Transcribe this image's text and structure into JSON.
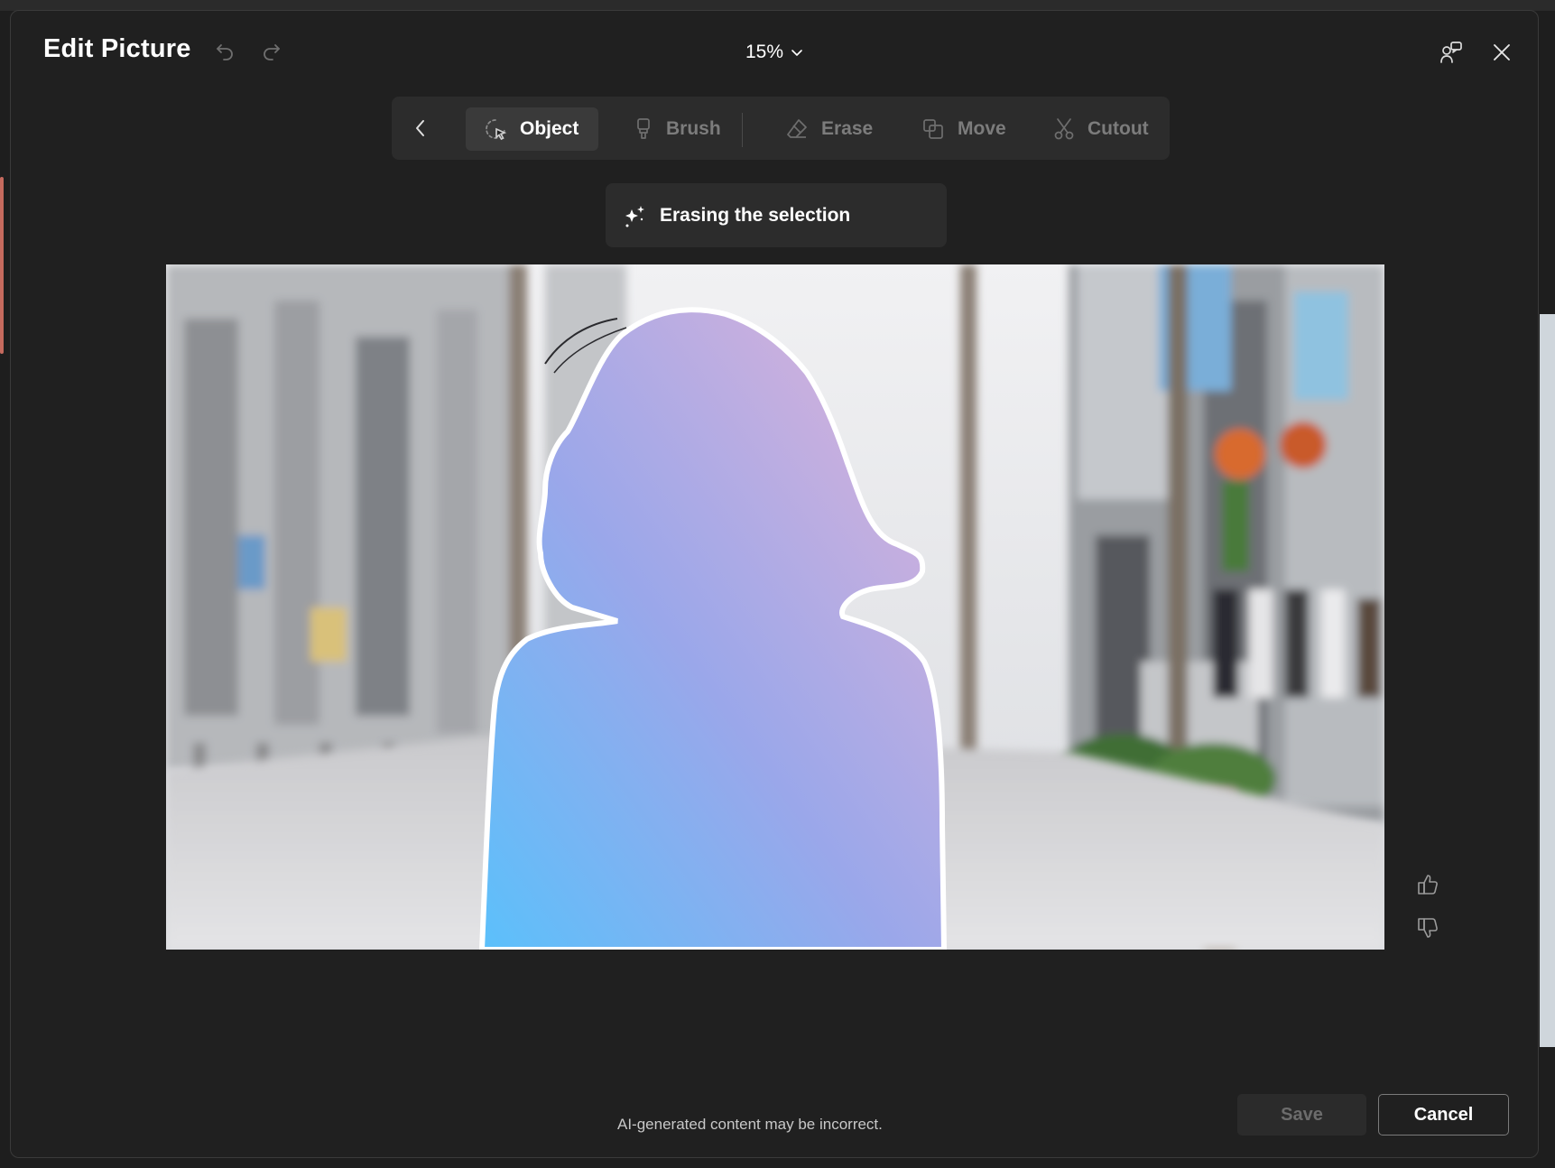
{
  "dialog": {
    "title": "Edit Picture",
    "zoom": "15%"
  },
  "toolbar": {
    "items": [
      {
        "label": "Object",
        "icon": "object-select-icon",
        "active": true
      },
      {
        "label": "Brush",
        "icon": "brush-icon",
        "active": false
      },
      {
        "label": "Erase",
        "icon": "eraser-icon",
        "active": false
      },
      {
        "label": "Move",
        "icon": "move-icon",
        "active": false
      },
      {
        "label": "Cutout",
        "icon": "scissors-icon",
        "active": false
      }
    ]
  },
  "status": {
    "text": "Erasing the selection",
    "icon": "sparkle-icon"
  },
  "footer": {
    "disclaimer": "AI-generated content may be incorrect.",
    "save_label": "Save",
    "cancel_label": "Cancel"
  },
  "colors": {
    "dialog_bg": "#202020",
    "toolbar_bg": "#2c2c2c",
    "selection_gradient_start": "#5bc0fb",
    "selection_gradient_end": "#d9aee0"
  }
}
